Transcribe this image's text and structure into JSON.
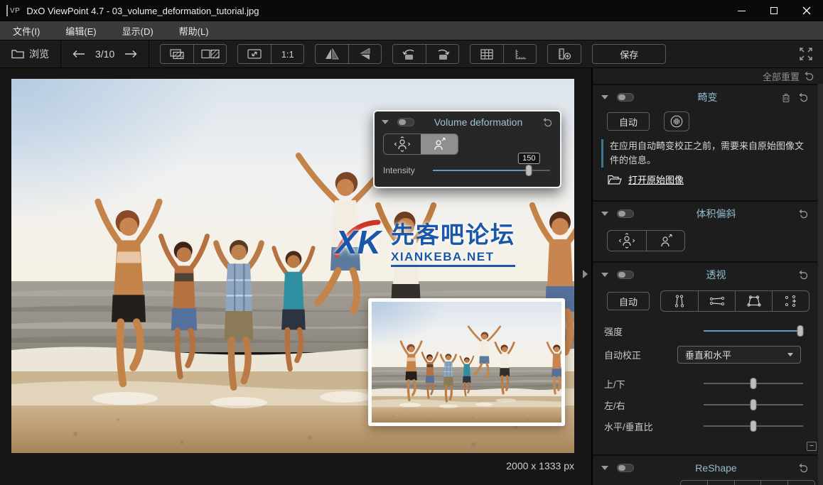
{
  "window": {
    "logo_text": "VP",
    "title": "DxO ViewPoint 4.7 - 03_volume_deformation_tutorial.jpg"
  },
  "menu": {
    "items": [
      {
        "label": "文件(I)"
      },
      {
        "label": "编辑(E)"
      },
      {
        "label": "显示(D)"
      },
      {
        "label": "帮助(L)"
      }
    ]
  },
  "toolbar": {
    "browse_label": "浏览",
    "nav_position": "3/10",
    "one_to_one_label": "1:1",
    "save_label": "保存"
  },
  "viewer": {
    "status_dimensions": "2000 x 1333 px",
    "watermark": {
      "logo_text": "XK",
      "line1": "先客吧论坛",
      "line2": "XIANKEBA.NET"
    }
  },
  "float_panel": {
    "title": "Volume deformation",
    "intensity_label": "Intensity",
    "intensity_value": "150"
  },
  "sidebar": {
    "reset_all_label": "全部重置",
    "collapse_glyph": "−",
    "distortion": {
      "title": "畸变",
      "auto_label": "自动",
      "info_text": "在应用自动畸变校正之前，需要来自原始图像文件的信息。",
      "open_original_label": "打开原始图像"
    },
    "volume": {
      "title": "体积偏斜"
    },
    "perspective": {
      "title": "透视",
      "auto_label": "自动",
      "intensity_label": "强度",
      "auto_correct_label": "自动校正",
      "auto_correct_value": "垂直和水平",
      "up_down_label": "上/下",
      "left_right_label": "左/右",
      "hv_ratio_label": "水平/垂直比"
    },
    "reshape": {
      "title": "ReShape"
    }
  },
  "colors": {
    "accent_blue": "#5b9ec9",
    "panel_title": "#93bdd2",
    "watermark_blue": "#1a57a8",
    "watermark_red": "#cf3328"
  }
}
